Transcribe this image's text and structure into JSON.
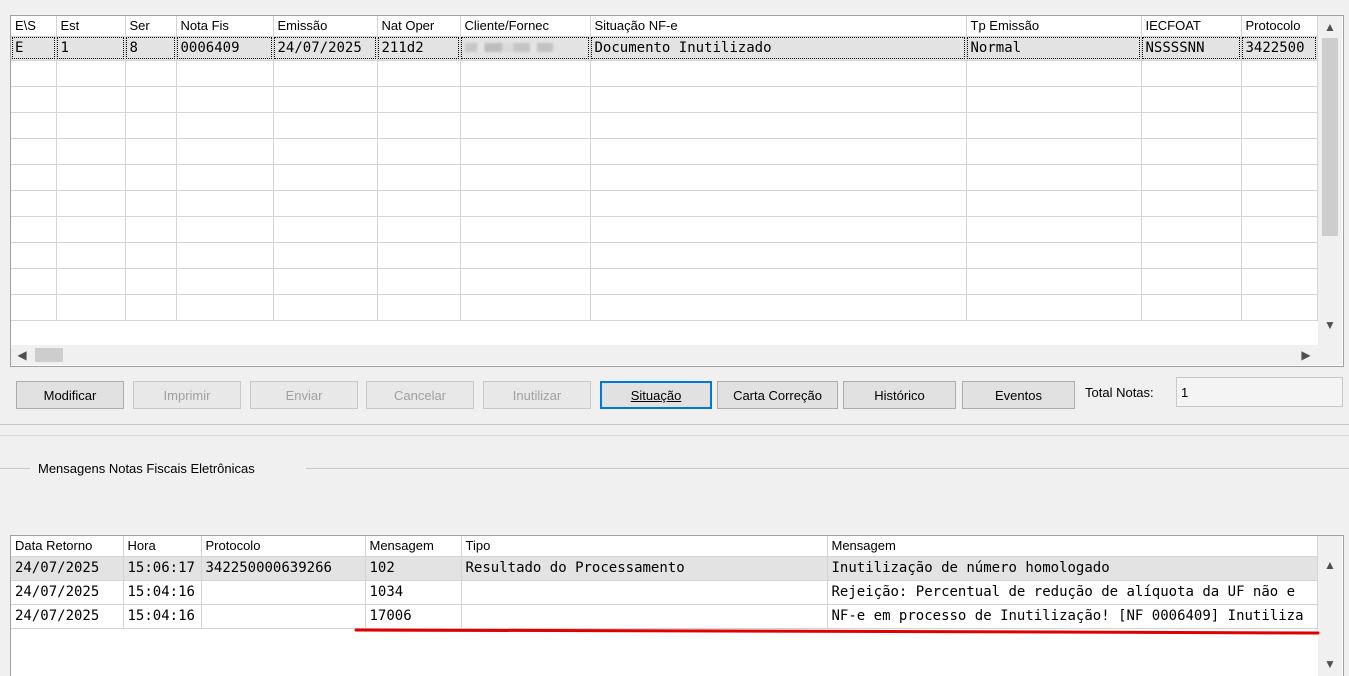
{
  "top_grid": {
    "columns": [
      "E\\S",
      "Est",
      "Ser",
      "Nota Fis",
      "Emissão",
      "Nat Oper",
      "Cliente/Fornec",
      "Situação NF-e",
      "Tp Emissão",
      "IECFOAT",
      "Protocolo"
    ],
    "rows": [
      [
        "E",
        "1",
        "8",
        "0006409",
        "24/07/2025",
        "211d2",
        "",
        "Documento Inutilizado",
        "Normal",
        "NSSSSNN",
        "3422500"
      ]
    ],
    "empty_rows": 10
  },
  "buttons": {
    "modificar": "Modificar",
    "imprimir": "Imprimir",
    "enviar": "Enviar",
    "cancelar": "Cancelar",
    "inutilizar": "Inutilizar",
    "situacao": "Situação",
    "carta_correcao": "Carta Correção",
    "historico": "Histórico",
    "eventos": "Eventos"
  },
  "total_notas": {
    "label": "Total Notas:",
    "value": "1"
  },
  "messages_section": {
    "title": "Mensagens Notas Fiscais Eletrônicas"
  },
  "bottom_grid": {
    "columns": [
      "Data Retorno",
      "Hora",
      "Protocolo",
      "Mensagem",
      "Tipo",
      "Mensagem"
    ],
    "rows": [
      [
        "24/07/2025",
        "15:06:17",
        "342250000639266",
        "102",
        "Resultado do Processamento",
        "Inutilização de número homologado"
      ],
      [
        "24/07/2025",
        "15:04:16",
        "",
        "1034",
        "",
        "Rejeição: Percentual de redução de alíquota da UF não e"
      ],
      [
        "24/07/2025",
        "15:04:16",
        "",
        "17006",
        "",
        "NF-e em processo de Inutilização! [NF 0006409] Inutiliza"
      ]
    ]
  },
  "annotation": {
    "color": "#e00000"
  },
  "icons": {
    "scroll_up": "▲",
    "scroll_down": "▼",
    "scroll_left": "◀",
    "scroll_right": "▶"
  }
}
